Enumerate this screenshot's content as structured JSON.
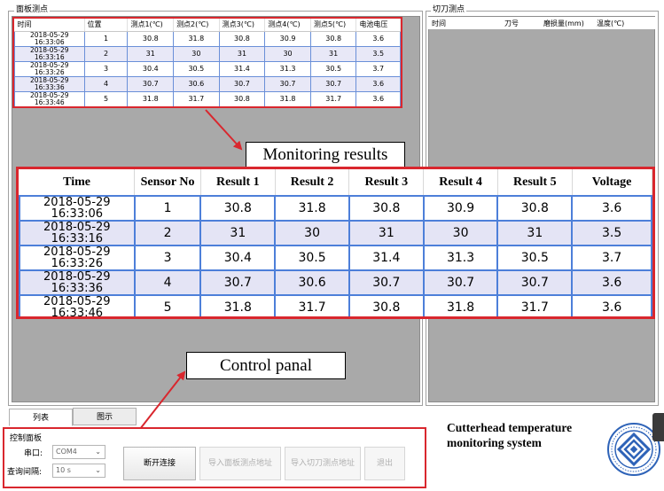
{
  "panels": {
    "left_title": "面板测点",
    "right_title": "切刀测点"
  },
  "small_table": {
    "headers": [
      "时间",
      "位置",
      "测点1(℃)",
      "测点2(℃)",
      "测点3(℃)",
      "测点4(℃)",
      "测点5(℃)",
      "电池电压"
    ],
    "rows": [
      [
        "2018-05-29 16:33:06",
        "1",
        "30.8",
        "31.8",
        "30.8",
        "30.9",
        "30.8",
        "3.6"
      ],
      [
        "2018-05-29 16:33:16",
        "2",
        "31",
        "30",
        "31",
        "30",
        "31",
        "3.5"
      ],
      [
        "2018-05-29 16:33:26",
        "3",
        "30.4",
        "30.5",
        "31.4",
        "31.3",
        "30.5",
        "3.7"
      ],
      [
        "2018-05-29 16:33:36",
        "4",
        "30.7",
        "30.6",
        "30.7",
        "30.7",
        "30.7",
        "3.6"
      ],
      [
        "2018-05-29 16:33:46",
        "5",
        "31.8",
        "31.7",
        "30.8",
        "31.8",
        "31.7",
        "3.6"
      ]
    ]
  },
  "right_table": {
    "headers": [
      "时间",
      "刀号",
      "磨损量(mm)",
      "温度(℃)"
    ]
  },
  "annotations": {
    "monitoring": "Monitoring results",
    "control": "Control panal"
  },
  "big_table": {
    "headers": [
      "Time",
      "Sensor No",
      "Result 1",
      "Result 2",
      "Result 3",
      "Result 4",
      "Result 5",
      "Voltage"
    ],
    "rows": [
      [
        "2018-05-29 16:33:06",
        "1",
        "30.8",
        "31.8",
        "30.8",
        "30.9",
        "30.8",
        "3.6"
      ],
      [
        "2018-05-29 16:33:16",
        "2",
        "31",
        "30",
        "31",
        "30",
        "31",
        "3.5"
      ],
      [
        "2018-05-29 16:33:26",
        "3",
        "30.4",
        "30.5",
        "31.4",
        "31.3",
        "30.5",
        "3.7"
      ],
      [
        "2018-05-29 16:33:36",
        "4",
        "30.7",
        "30.6",
        "30.7",
        "30.7",
        "30.7",
        "3.6"
      ],
      [
        "2018-05-29 16:33:46",
        "5",
        "31.8",
        "31.7",
        "30.8",
        "31.8",
        "31.7",
        "3.6"
      ]
    ]
  },
  "tabs": [
    "列表",
    "图示"
  ],
  "control": {
    "title": "控制面板",
    "port_label": "串口:",
    "port_value": "COM4",
    "interval_label": "查询间隔:",
    "interval_value": "10 s",
    "buttons": {
      "disconnect": "断开连接",
      "import_panel": "导入面板测点地址",
      "import_cutter": "导入切刀测点地址",
      "exit": "退出"
    }
  },
  "brand": {
    "line1": "Cutterhead temperature",
    "line2": "monitoring system"
  },
  "colors": {
    "highlight": "#d9272e",
    "grid_blue": "#4d7fd9",
    "alt_row": "#e4e4f5",
    "gray_area": "#a9a9a9"
  }
}
